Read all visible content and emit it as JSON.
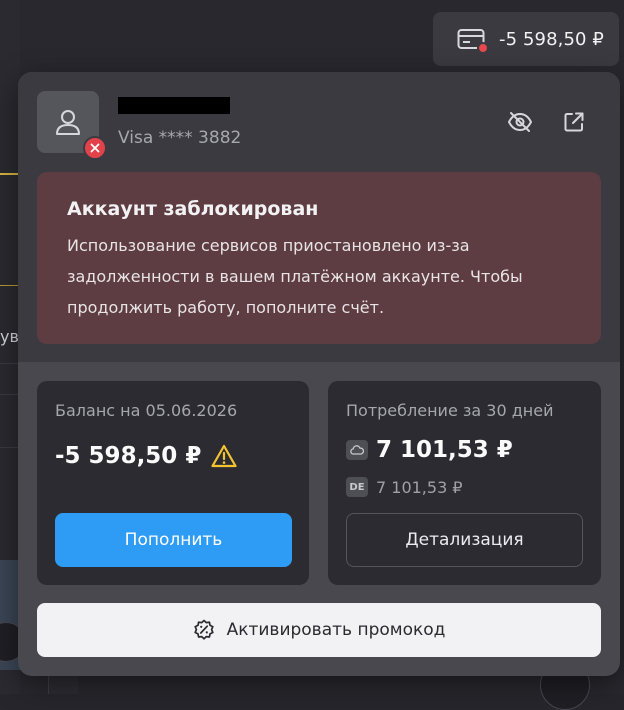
{
  "header": {
    "balance_pill_amount": "-5 598,50 ₽"
  },
  "background": {
    "fragment_text": "ув"
  },
  "account": {
    "card_number": "Visa **** 3882"
  },
  "alert": {
    "title": "Аккаунт заблокирован",
    "body": "Использование сервисов приостановлено из-за задолженности в вашем платёжном аккаунте. Чтобы продолжить работу, пополните счёт."
  },
  "balance": {
    "label": "Баланс на 05.06.2026",
    "value": "-5 598,50 ₽",
    "topup_label": "Пополнить"
  },
  "consumption": {
    "label": "Потребление за 30 дней",
    "cloud_total": "7 101,53 ₽",
    "de_badge": "DE",
    "de_total": "7 101,53 ₽",
    "details_label": "Детализация"
  },
  "promo": {
    "label": "Активировать промокод"
  },
  "colors": {
    "accent_blue": "#2e9cf4",
    "alert_bg": "#5e3d42",
    "error_red": "#e2434a",
    "warning_yellow": "#f3c431"
  }
}
